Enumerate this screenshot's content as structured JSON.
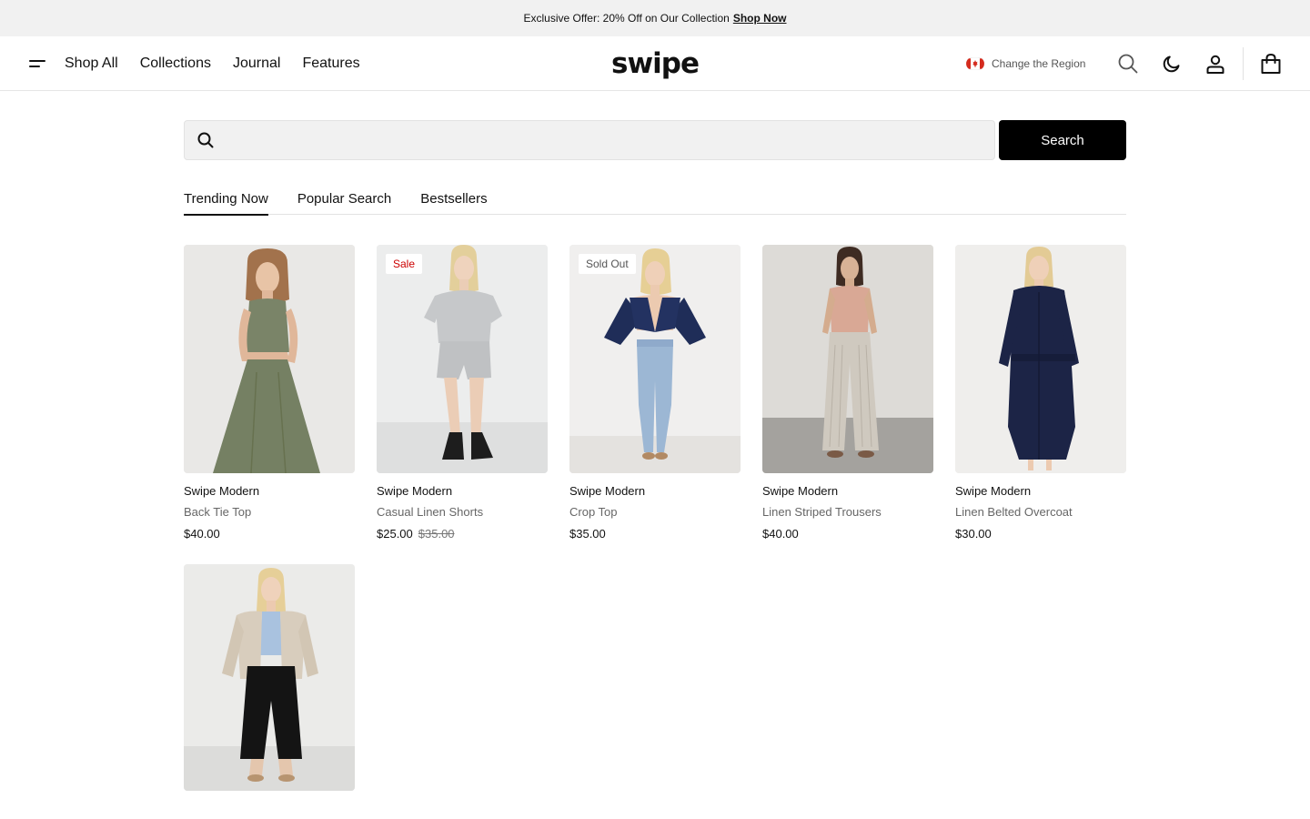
{
  "announcement": {
    "text": "Exclusive Offer: 20% Off on Our Collection",
    "link": "Shop Now"
  },
  "header": {
    "nav": [
      "Shop All",
      "Collections",
      "Journal",
      "Features"
    ],
    "logo": "swipe",
    "region_label": "Change the Region"
  },
  "search": {
    "placeholder": "",
    "value": "",
    "button": "Search"
  },
  "tabs": [
    "Trending Now",
    "Popular Search",
    "Bestsellers"
  ],
  "active_tab": "Trending Now",
  "products": [
    {
      "brand": "Swipe Modern",
      "name": "Back Tie Top",
      "price": "$40.00",
      "compare_price": "",
      "badge": ""
    },
    {
      "brand": "Swipe Modern",
      "name": "Casual Linen Shorts",
      "price": "$25.00",
      "compare_price": "$35.00",
      "badge": "Sale"
    },
    {
      "brand": "Swipe Modern",
      "name": "Crop Top",
      "price": "$35.00",
      "compare_price": "",
      "badge": "Sold Out"
    },
    {
      "brand": "Swipe Modern",
      "name": "Linen Striped Trousers",
      "price": "$40.00",
      "compare_price": "",
      "badge": ""
    },
    {
      "brand": "Swipe Modern",
      "name": "Linen Belted Overcoat",
      "price": "$30.00",
      "compare_price": "",
      "badge": ""
    },
    {
      "brand": "",
      "name": "",
      "price": "",
      "compare_price": "",
      "badge": ""
    }
  ],
  "colors": {
    "sale": "#cc0000",
    "accent": "#000000",
    "banner_bg": "#f1f1f1"
  },
  "icons": [
    "menu-icon",
    "canada-flag-icon",
    "search-icon",
    "moon-icon",
    "user-icon",
    "shopping-bag-icon"
  ]
}
